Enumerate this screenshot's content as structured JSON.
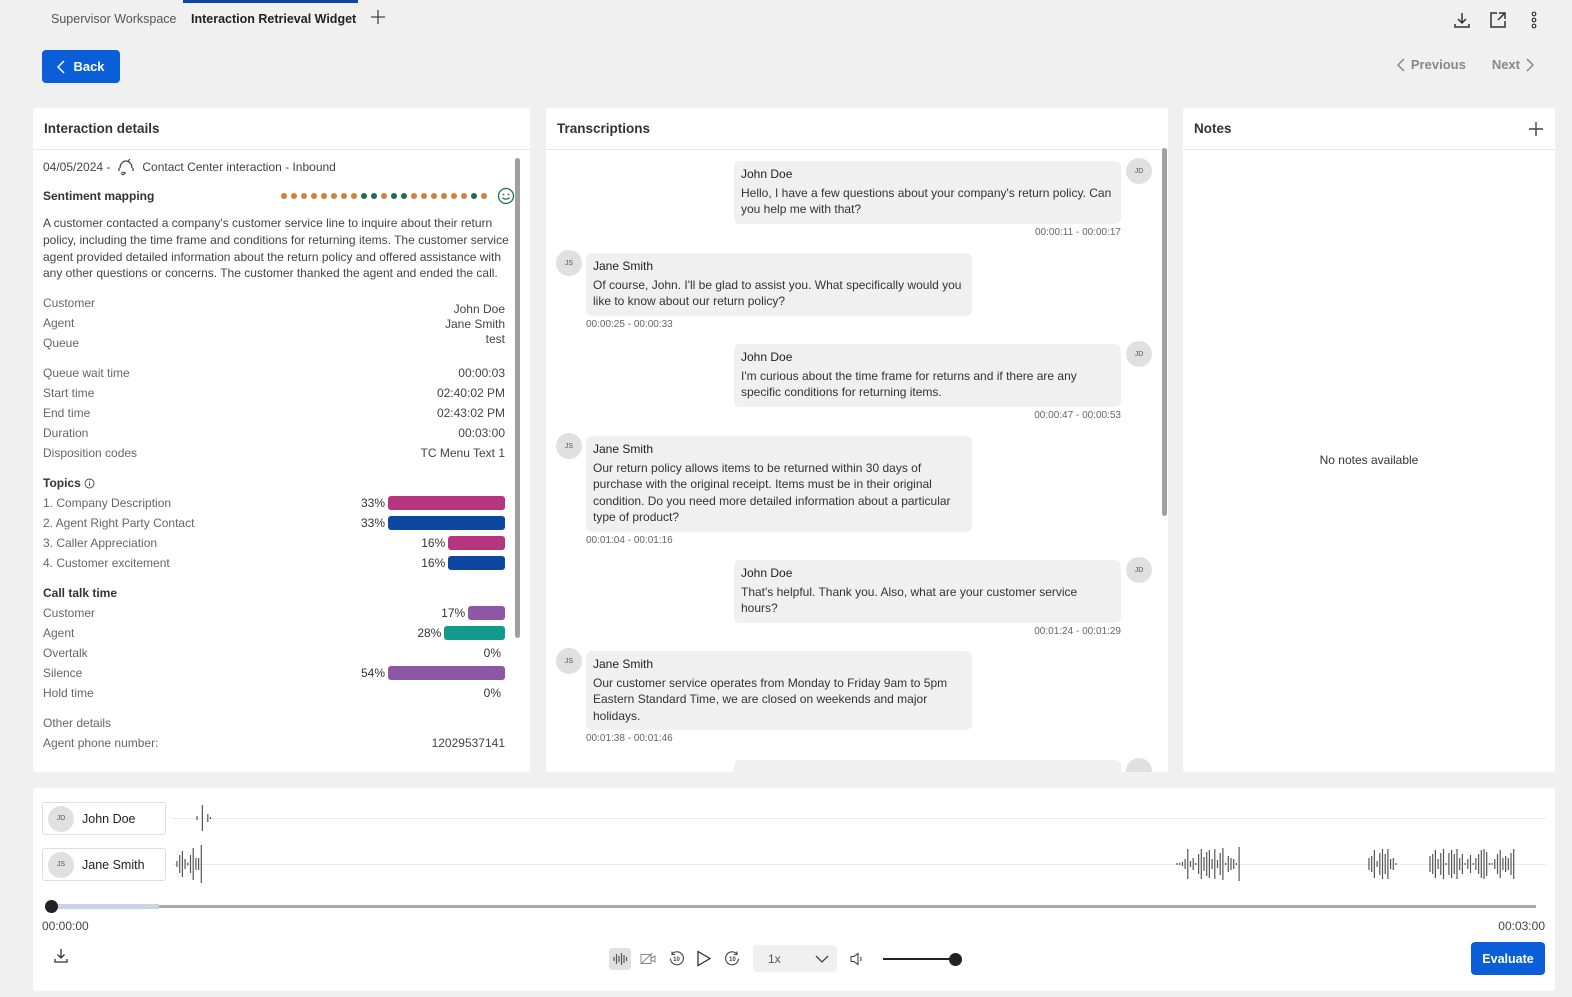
{
  "tabs": [
    {
      "label": "Supervisor Workspace",
      "active": false
    },
    {
      "label": "Interaction Retrieval Widget",
      "active": true
    }
  ],
  "top_icons": [
    "download-icon",
    "external-link-icon",
    "more-vertical-icon"
  ],
  "nav": {
    "back_label": "Back",
    "previous_label": "Previous",
    "next_label": "Next"
  },
  "details": {
    "title": "Interaction details",
    "date": "04/05/2024 -",
    "channel": "Contact Center interaction - Inbound",
    "sentiment_label": "Sentiment mapping",
    "sentiment_dots": [
      "o",
      "o",
      "o",
      "o",
      "o",
      "o",
      "o",
      "o",
      "g",
      "g",
      "o",
      "g",
      "g",
      "o",
      "o",
      "o",
      "o",
      "o",
      "o",
      "g",
      "o"
    ],
    "sentiment_colors": {
      "o": "#d0823a",
      "g": "#1f6e4a"
    },
    "summary": "A customer contacted a company's customer service line to inquire about their return policy, including the time frame and conditions for returning items. The customer service agent provided detailed information about the return policy and offered assistance with any other questions or concerns. The customer thanked the agent and ended the call.",
    "people": {
      "labels": [
        "Customer",
        "Agent",
        "Queue"
      ],
      "values": [
        "John Doe",
        "Jane Smith",
        "test"
      ]
    },
    "fields": [
      {
        "label": "Queue wait time",
        "value": "00:00:03"
      },
      {
        "label": "Start time",
        "value": "02:40:02 PM"
      },
      {
        "label": "End time",
        "value": "02:43:02 PM"
      },
      {
        "label": "Duration",
        "value": "00:03:00"
      },
      {
        "label": "Disposition codes",
        "value": "TC Menu Text 1"
      }
    ],
    "topics_title": "Topics",
    "topics": [
      {
        "label": "1. Company Description",
        "pct": "33%",
        "value": 33,
        "color": "#b5357f"
      },
      {
        "label": "2. Agent Right Party Contact",
        "pct": "33%",
        "value": 33,
        "color": "#0d47a1"
      },
      {
        "label": "3. Caller Appreciation",
        "pct": "16%",
        "value": 16,
        "color": "#b5357f"
      },
      {
        "label": "4. Customer excitement",
        "pct": "16%",
        "value": 16,
        "color": "#0d47a1"
      }
    ],
    "talk_title": "Call talk time",
    "talk": [
      {
        "label": "Customer",
        "pct": "17%",
        "value": 17,
        "color": "#8e57a6"
      },
      {
        "label": "Agent",
        "pct": "28%",
        "value": 28,
        "color": "#109b8a"
      },
      {
        "label": "Overtalk",
        "pct": "0%",
        "value": 0,
        "color": "#8e57a6"
      },
      {
        "label": "Silence",
        "pct": "54%",
        "value": 54,
        "color": "#8e57a6"
      },
      {
        "label": "Hold time",
        "pct": "0%",
        "value": 0,
        "color": "#8e57a6"
      }
    ],
    "other_title": "Other details",
    "other": [
      {
        "label": "Agent phone number:",
        "value": "12029537141"
      }
    ]
  },
  "transcript": {
    "title": "Transcriptions",
    "messages": [
      {
        "side": "right",
        "initials": "JD",
        "name": "John Doe",
        "text": "Hello, I have a few questions about your company's return policy. Can you help me with that?",
        "time": "00:00:11 - 00:00:17"
      },
      {
        "side": "left",
        "initials": "JS",
        "name": "Jane Smith",
        "text": "Of course, John. I'll be glad to assist you. What specifically would you like to know about our return policy?",
        "time": "00:00:25 - 00:00:33"
      },
      {
        "side": "right",
        "initials": "JD",
        "name": "John Doe",
        "text": "I'm curious about the time frame for returns and if there are any specific conditions for returning items.",
        "time": "00:00:47 - 00:00:53"
      },
      {
        "side": "left",
        "initials": "JS",
        "name": "Jane Smith",
        "text": "Our return policy allows items to be returned within 30 days of purchase with the original receipt. Items must be in their original condition. Do you need more detailed information about a particular type of product?",
        "time": "00:01:04 - 00:01:16"
      },
      {
        "side": "right",
        "initials": "JD",
        "name": "John Doe",
        "text": "That's helpful. Thank you. Also, what are your customer service hours?",
        "time": "00:01:24 - 00:01:29"
      },
      {
        "side": "left",
        "initials": "JS",
        "name": "Jane Smith",
        "text": "Our customer service operates from Monday to Friday 9am to 5pm Eastern Standard Time, we are closed on weekends and major holidays.",
        "time": "00:01:38 - 00:01:46"
      }
    ]
  },
  "notes": {
    "title": "Notes",
    "empty": "No notes available"
  },
  "player": {
    "speakers": [
      {
        "initials": "JD",
        "name": "John Doe"
      },
      {
        "initials": "JS",
        "name": "Jane Smith"
      }
    ],
    "current_time": "00:00:00",
    "total_time": "00:03:00",
    "progress": 0,
    "buffered": 0.073,
    "speed": "1x",
    "volume": 1.0,
    "evaluate_label": "Evaluate"
  }
}
